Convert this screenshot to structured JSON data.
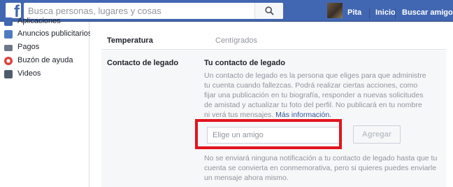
{
  "header": {
    "logo_letter": "f",
    "search_placeholder": "Busca personas, lugares y cosas",
    "user_name": "Pita",
    "nav_home": "Inicio",
    "nav_find_friends": "Buscar amigos",
    "icons": {
      "logo": "facebook-logo",
      "search": "search-icon",
      "avatar": "user-avatar"
    },
    "brand_color": "#4267b2"
  },
  "sidebar": {
    "items": [
      {
        "label": "Aplicaciones",
        "icon": "apps-icon",
        "color": "#4267b2"
      },
      {
        "label": "Anuncios publicitarios",
        "icon": "ads-icon",
        "color": "#4e7cc2"
      },
      {
        "label": "Pagos",
        "icon": "payments-icon",
        "color": "#6a7888"
      },
      {
        "label": "Buzón de ayuda",
        "icon": "help-inbox-icon",
        "color": "#e0403a"
      },
      {
        "label": "Videos",
        "icon": "videos-icon",
        "color": "#505c6d"
      }
    ]
  },
  "settings": {
    "temperature_label": "Temperatura",
    "temperature_value": "Centígrados",
    "legacy_label": "Contacto de legado",
    "legacy_title": "Tu contacto de legado",
    "legacy_description": "Un contacto de legado es la persona que eliges para que administre tu cuenta cuando fallezcas. Podrá realizar ciertas acciones, como fijar una publicación en tu biografía, responder a nuevas solicitudes de amistad y actualizar tu foto del perfil. No publicará en tu nombre ni verá tus mensajes.",
    "legacy_more_link": "Más información.",
    "friend_input_placeholder": "Elige un amigo",
    "add_button": "Agregar",
    "legacy_note": "No se enviará ninguna notificación a tu contacto de legado hasta que tu cuenta se convierta en conmemorativa, pero si quieres puedes enviarle un mensaje ahora mismo.",
    "highlight_color": "#e1141e"
  }
}
